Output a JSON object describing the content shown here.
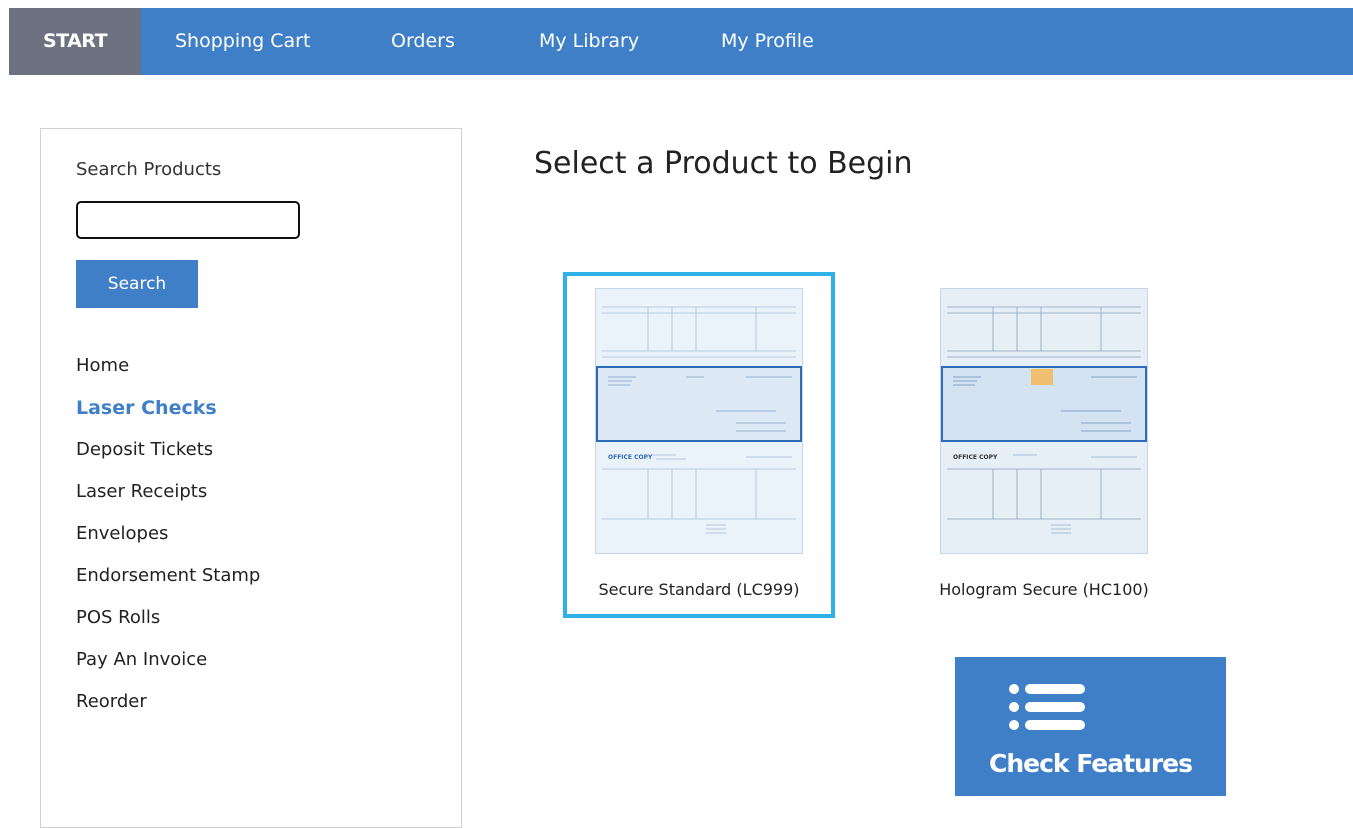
{
  "nav": {
    "start": "START",
    "items": [
      "Shopping Cart",
      "Orders",
      "My Library",
      "My Profile"
    ]
  },
  "sidebar": {
    "search_label": "Search Products",
    "search_value": "",
    "search_button": "Search",
    "categories": [
      "Home",
      "Laser Checks",
      "Deposit Tickets",
      "Laser Receipts",
      "Envelopes",
      "Endorsement Stamp",
      "POS Rolls",
      "Pay An Invoice",
      "Reorder"
    ],
    "active_category": "Laser Checks"
  },
  "main": {
    "title": "Select a Product to Begin",
    "products": [
      {
        "label": "Secure Standard (LC999)",
        "selected": true,
        "stub_text": "OFFICE COPY"
      },
      {
        "label": "Hologram Secure (HC100)",
        "selected": false,
        "stub_text": "OFFICE COPY"
      }
    ],
    "features_button": "Check Features"
  },
  "colors": {
    "nav_bg": "#3f7fc7",
    "start_bg": "#6e7280",
    "selected_border": "#2fb0e6",
    "accent": "#3f7fc7"
  },
  "icons": {
    "features": "list-icon"
  }
}
